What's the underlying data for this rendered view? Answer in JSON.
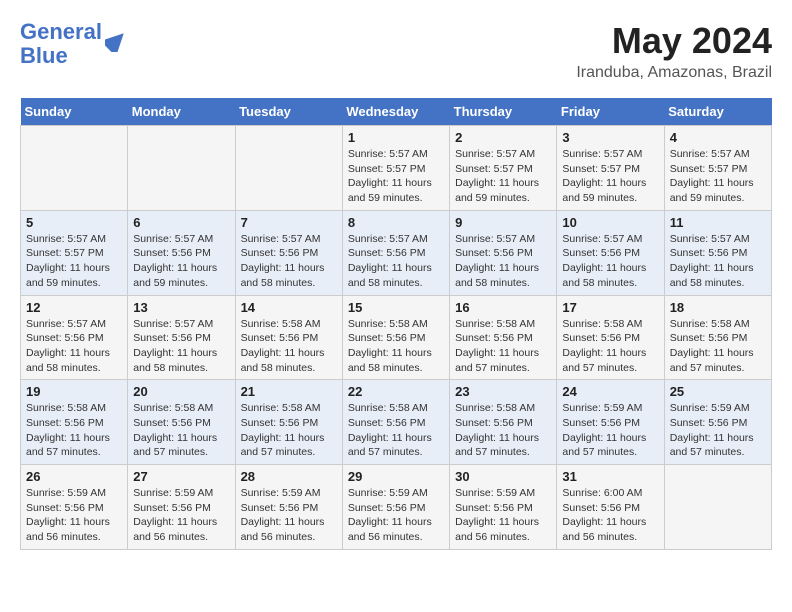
{
  "header": {
    "logo_line1": "General",
    "logo_line2": "Blue",
    "month": "May 2024",
    "location": "Iranduba, Amazonas, Brazil"
  },
  "days_of_week": [
    "Sunday",
    "Monday",
    "Tuesday",
    "Wednesday",
    "Thursday",
    "Friday",
    "Saturday"
  ],
  "weeks": [
    [
      {
        "day": "",
        "info": ""
      },
      {
        "day": "",
        "info": ""
      },
      {
        "day": "",
        "info": ""
      },
      {
        "day": "1",
        "info": "Sunrise: 5:57 AM\nSunset: 5:57 PM\nDaylight: 11 hours and 59 minutes."
      },
      {
        "day": "2",
        "info": "Sunrise: 5:57 AM\nSunset: 5:57 PM\nDaylight: 11 hours and 59 minutes."
      },
      {
        "day": "3",
        "info": "Sunrise: 5:57 AM\nSunset: 5:57 PM\nDaylight: 11 hours and 59 minutes."
      },
      {
        "day": "4",
        "info": "Sunrise: 5:57 AM\nSunset: 5:57 PM\nDaylight: 11 hours and 59 minutes."
      }
    ],
    [
      {
        "day": "5",
        "info": "Sunrise: 5:57 AM\nSunset: 5:57 PM\nDaylight: 11 hours and 59 minutes."
      },
      {
        "day": "6",
        "info": "Sunrise: 5:57 AM\nSunset: 5:56 PM\nDaylight: 11 hours and 59 minutes."
      },
      {
        "day": "7",
        "info": "Sunrise: 5:57 AM\nSunset: 5:56 PM\nDaylight: 11 hours and 58 minutes."
      },
      {
        "day": "8",
        "info": "Sunrise: 5:57 AM\nSunset: 5:56 PM\nDaylight: 11 hours and 58 minutes."
      },
      {
        "day": "9",
        "info": "Sunrise: 5:57 AM\nSunset: 5:56 PM\nDaylight: 11 hours and 58 minutes."
      },
      {
        "day": "10",
        "info": "Sunrise: 5:57 AM\nSunset: 5:56 PM\nDaylight: 11 hours and 58 minutes."
      },
      {
        "day": "11",
        "info": "Sunrise: 5:57 AM\nSunset: 5:56 PM\nDaylight: 11 hours and 58 minutes."
      }
    ],
    [
      {
        "day": "12",
        "info": "Sunrise: 5:57 AM\nSunset: 5:56 PM\nDaylight: 11 hours and 58 minutes."
      },
      {
        "day": "13",
        "info": "Sunrise: 5:57 AM\nSunset: 5:56 PM\nDaylight: 11 hours and 58 minutes."
      },
      {
        "day": "14",
        "info": "Sunrise: 5:58 AM\nSunset: 5:56 PM\nDaylight: 11 hours and 58 minutes."
      },
      {
        "day": "15",
        "info": "Sunrise: 5:58 AM\nSunset: 5:56 PM\nDaylight: 11 hours and 58 minutes."
      },
      {
        "day": "16",
        "info": "Sunrise: 5:58 AM\nSunset: 5:56 PM\nDaylight: 11 hours and 57 minutes."
      },
      {
        "day": "17",
        "info": "Sunrise: 5:58 AM\nSunset: 5:56 PM\nDaylight: 11 hours and 57 minutes."
      },
      {
        "day": "18",
        "info": "Sunrise: 5:58 AM\nSunset: 5:56 PM\nDaylight: 11 hours and 57 minutes."
      }
    ],
    [
      {
        "day": "19",
        "info": "Sunrise: 5:58 AM\nSunset: 5:56 PM\nDaylight: 11 hours and 57 minutes."
      },
      {
        "day": "20",
        "info": "Sunrise: 5:58 AM\nSunset: 5:56 PM\nDaylight: 11 hours and 57 minutes."
      },
      {
        "day": "21",
        "info": "Sunrise: 5:58 AM\nSunset: 5:56 PM\nDaylight: 11 hours and 57 minutes."
      },
      {
        "day": "22",
        "info": "Sunrise: 5:58 AM\nSunset: 5:56 PM\nDaylight: 11 hours and 57 minutes."
      },
      {
        "day": "23",
        "info": "Sunrise: 5:58 AM\nSunset: 5:56 PM\nDaylight: 11 hours and 57 minutes."
      },
      {
        "day": "24",
        "info": "Sunrise: 5:59 AM\nSunset: 5:56 PM\nDaylight: 11 hours and 57 minutes."
      },
      {
        "day": "25",
        "info": "Sunrise: 5:59 AM\nSunset: 5:56 PM\nDaylight: 11 hours and 57 minutes."
      }
    ],
    [
      {
        "day": "26",
        "info": "Sunrise: 5:59 AM\nSunset: 5:56 PM\nDaylight: 11 hours and 56 minutes."
      },
      {
        "day": "27",
        "info": "Sunrise: 5:59 AM\nSunset: 5:56 PM\nDaylight: 11 hours and 56 minutes."
      },
      {
        "day": "28",
        "info": "Sunrise: 5:59 AM\nSunset: 5:56 PM\nDaylight: 11 hours and 56 minutes."
      },
      {
        "day": "29",
        "info": "Sunrise: 5:59 AM\nSunset: 5:56 PM\nDaylight: 11 hours and 56 minutes."
      },
      {
        "day": "30",
        "info": "Sunrise: 5:59 AM\nSunset: 5:56 PM\nDaylight: 11 hours and 56 minutes."
      },
      {
        "day": "31",
        "info": "Sunrise: 6:00 AM\nSunset: 5:56 PM\nDaylight: 11 hours and 56 minutes."
      },
      {
        "day": "",
        "info": ""
      }
    ]
  ]
}
